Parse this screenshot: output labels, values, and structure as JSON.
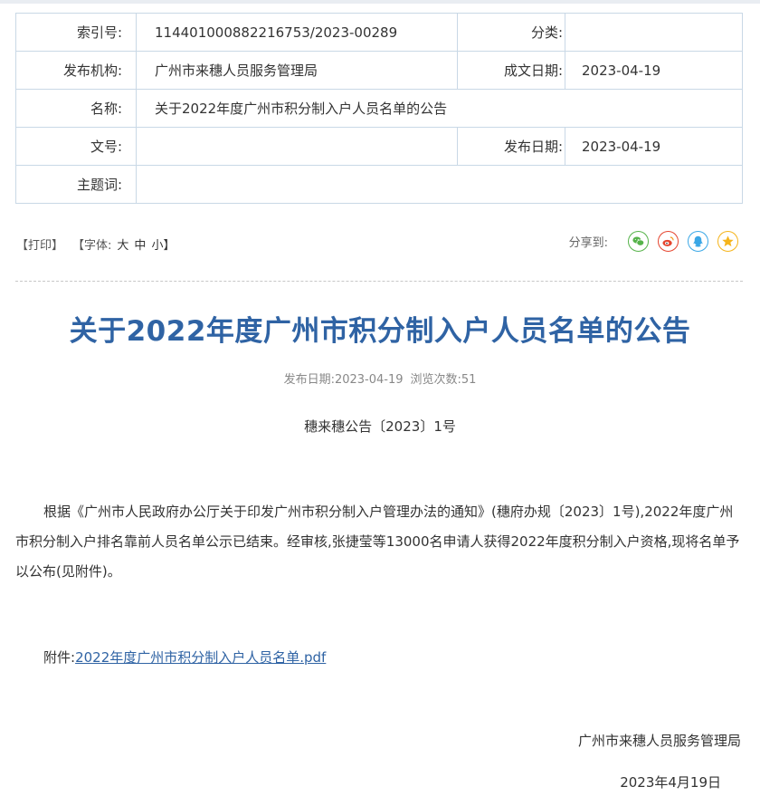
{
  "meta": {
    "index_label": "索引号:",
    "index_value": "114401000882216753/2023-00289",
    "category_label": "分类:",
    "category_value": "",
    "org_label": "发布机构:",
    "org_value": "广州市来穗人员服务管理局",
    "written_date_label": "成文日期:",
    "written_date_value": "2023-04-19",
    "name_label": "名称:",
    "name_value": "关于2022年度广州市积分制入户人员名单的公告",
    "docnum_label": "文号:",
    "docnum_value": "",
    "pub_date_label": "发布日期:",
    "pub_date_value": "2023-04-19",
    "keywords_label": "主题词:",
    "keywords_value": ""
  },
  "tools": {
    "print": "【打印】",
    "font_prefix": "【字体:",
    "font_large": "大",
    "font_medium": "中",
    "font_small": "小】",
    "share_label": "分享到:"
  },
  "share_icons": [
    "wechat-icon",
    "weibo-icon",
    "qq-icon",
    "qzone-icon"
  ],
  "colors": {
    "title": "#2f63a4",
    "link": "#2f63a4",
    "wechat": "#56b34a",
    "weibo": "#e5452f",
    "qq": "#3aa7e6",
    "qzone": "#f5b41b"
  },
  "article": {
    "title": "关于2022年度广州市积分制入户人员名单的公告",
    "pub_date_text": "发布日期:2023-04-19",
    "views_text": "浏览次数:51",
    "doc_number": "穗来穗公告〔2023〕1号",
    "body": "根据《广州市人民政府办公厅关于印发广州市积分制入户管理办法的通知》(穗府办规〔2023〕1号),2022年度广州市积分制入户排名靠前人员名单公示已结束。经审核,张捷莹等13000名申请人获得2022年度积分制入户资格,现将名单予以公布(见附件)。",
    "attachment_label": "附件:",
    "attachment_link": "2022年度广州市积分制入户人员名单.pdf",
    "signature": "广州市来穗人员服务管理局",
    "date": "2023年4月19日"
  }
}
